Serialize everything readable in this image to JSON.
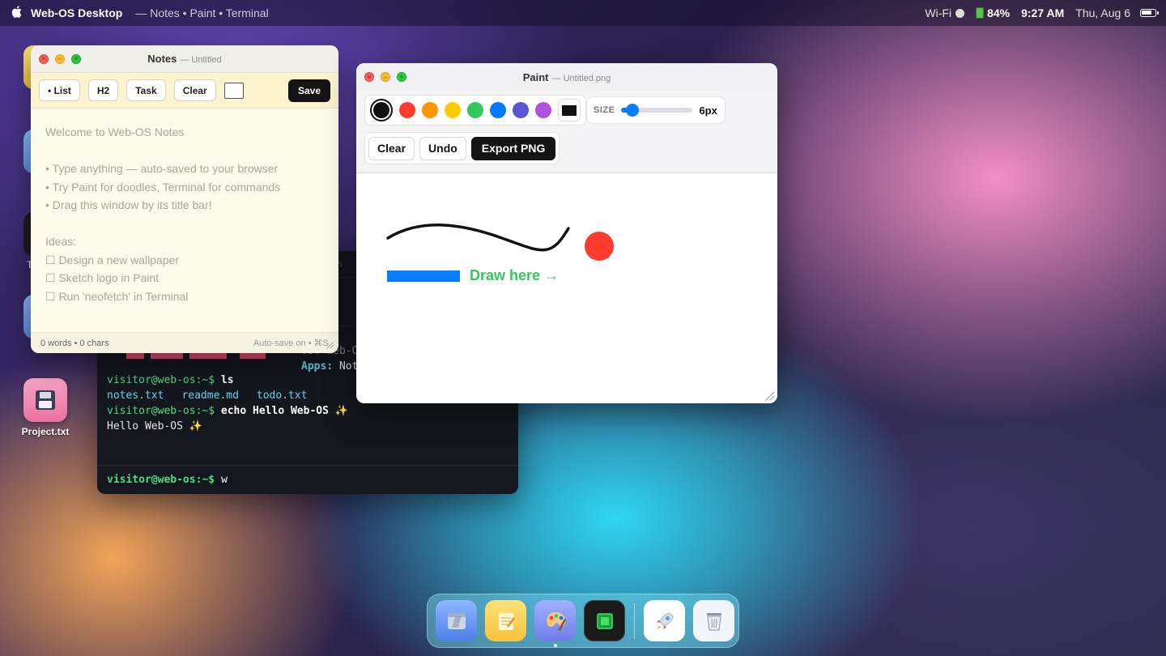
{
  "menubar": {
    "app_name": "Web-OS Desktop",
    "subtitle": "— Notes • Paint • Terminal",
    "wifi": "Wi-Fi",
    "battery": "84%",
    "time": "9:27 AM",
    "date": "Thu, Aug 6"
  },
  "desktop": {
    "project_label": "Project.txt",
    "partial_label": "T"
  },
  "notes": {
    "title": "Notes",
    "subtitle": "— Untitled",
    "toolbar": {
      "list": "• List",
      "h2": "H2",
      "task": "Task",
      "clear": "Clear",
      "save": "Save"
    },
    "lines": [
      "Welcome to Web-OS Notes",
      "",
      "• Type anything — auto-saved to your browser",
      "• Try Paint for doodles, Terminal for commands",
      "• Drag this window by its title bar!",
      "",
      "Ideas:",
      "☐ Design a new wallpaper",
      "☐ Sketch logo in Paint",
      "☐ Run 'neofetch' in Terminal"
    ],
    "footer_left": "0 words • 0 chars",
    "footer_right": "Auto-save on • ⌘S"
  },
  "terminal": {
    "partial_top": "h",
    "partial_mid": "n, ",
    "os_key": "OS:",
    "os_value": "Web-O",
    "apps_key": "Apps:",
    "apps_value": "Not",
    "prompt": "visitor@web-os:~$",
    "cmd1": "ls",
    "files": [
      "notes.txt",
      "readme.md",
      "todo.txt"
    ],
    "cmd2": "echo Hello Web-OS ✨",
    "output": "Hello Web-OS ✨",
    "typed": "w"
  },
  "paint": {
    "title": "Paint",
    "subtitle": "— Untitled.png",
    "palette": [
      "#111111",
      "#ff3b30",
      "#ff9500",
      "#ffcc00",
      "#34c759",
      "#007aff",
      "#5856d6",
      "#af52de"
    ],
    "size_label": "SIZE",
    "size_value": "6px",
    "brush_size_fraction": 0.15,
    "clear": "Clear",
    "undo": "Undo",
    "export": "Export PNG",
    "canvas_text": "Draw here →"
  },
  "dock": {
    "items": [
      "finder-icon",
      "notes-icon",
      "paint-icon",
      "terminal-icon",
      "launchpad-icon",
      "trash-icon"
    ]
  },
  "colors": {
    "accent": "#0a7cff",
    "terminal_prompt": "#4ade80",
    "canvas_text": "#34c759",
    "canvas_circle": "#ff3b30",
    "canvas_bar": "#0a7cff"
  }
}
